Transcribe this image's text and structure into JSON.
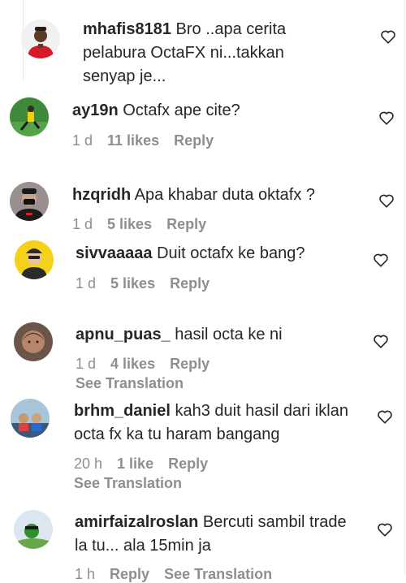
{
  "comments": [
    {
      "username": "mhafis8181",
      "text": "Bro ..apa cerita pelabura OctaFX ni...takkan senyap je..."
    },
    {
      "username": "ay19n",
      "text": "Octafx ape cite?",
      "time": "1 d",
      "likes": "11 likes",
      "reply": "Reply"
    },
    {
      "username": "hzqridh",
      "text": "Apa khabar duta oktafx ?",
      "time": "1 d",
      "likes": "5 likes",
      "reply": "Reply"
    },
    {
      "username": "sivvaaaaa",
      "text": "Duit octafx ke bang?",
      "time": "1 d",
      "likes": "5 likes",
      "reply": "Reply"
    },
    {
      "username": "apnu_puas_",
      "text": "hasil octa ke ni",
      "time": "1 d",
      "likes": "4 likes",
      "reply": "Reply",
      "translation": "See Translation"
    },
    {
      "username": "brhm_daniel",
      "text": "kah3 duit hasil dari iklan octa fx ka tu haram bangang",
      "time": "20 h",
      "likes": "1 like",
      "reply": "Reply",
      "translation": "See Translation"
    },
    {
      "username": "amirfaizalroslan",
      "text": "Bercuti sambil trade la tu... ala 15min ja",
      "time": "1 h",
      "reply": "Reply",
      "translation": "See Translation"
    }
  ],
  "icons": {
    "like": "heart-outline-icon",
    "avatar": "avatar"
  }
}
